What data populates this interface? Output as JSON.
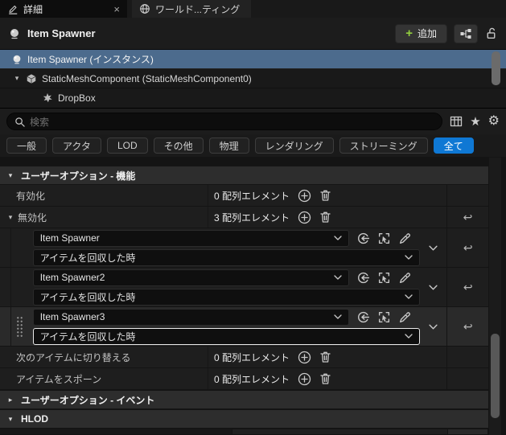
{
  "window": {
    "tab_details": "詳細",
    "tab_world": "ワールド...ティング"
  },
  "header": {
    "title": "Item Spawner",
    "add_button": "追加"
  },
  "component_tree": {
    "root": "Item Spawner (インスタンス)",
    "static_mesh": "StaticMeshComponent (StaticMeshComponent0)",
    "drop_box": "DropBox"
  },
  "search": {
    "placeholder": "検索"
  },
  "filters": {
    "items": [
      "一般",
      "アクタ",
      "LOD",
      "その他",
      "物理",
      "レンダリング",
      "ストリーミング",
      "全て"
    ],
    "active": "全て"
  },
  "sections": {
    "features": "ユーザーオプション - 機能",
    "events": "ユーザーオプション - イベント",
    "hlod": "HLOD"
  },
  "properties": {
    "enabled": {
      "name": "有効化",
      "value": "0 配列エレメント"
    },
    "disabled": {
      "name": "無効化",
      "value": "3 配列エレメント"
    },
    "switch_next": {
      "name": "次のアイテムに切り替える",
      "value": "0 配列エレメント"
    },
    "spawn": {
      "name": "アイテムをスポーン",
      "value": "0 配列エレメント"
    }
  },
  "disabled_elements": [
    {
      "target": "Item Spawner",
      "event": "アイテムを回収した時"
    },
    {
      "target": "Item Spawner2",
      "event": "アイテムを回収した時"
    },
    {
      "target": "Item Spawner3",
      "event": "アイテムを回収した時"
    }
  ],
  "colors": {
    "selection": "#4c6b8d",
    "accent": "#0f78d4",
    "add_green": "#93cf3f"
  }
}
